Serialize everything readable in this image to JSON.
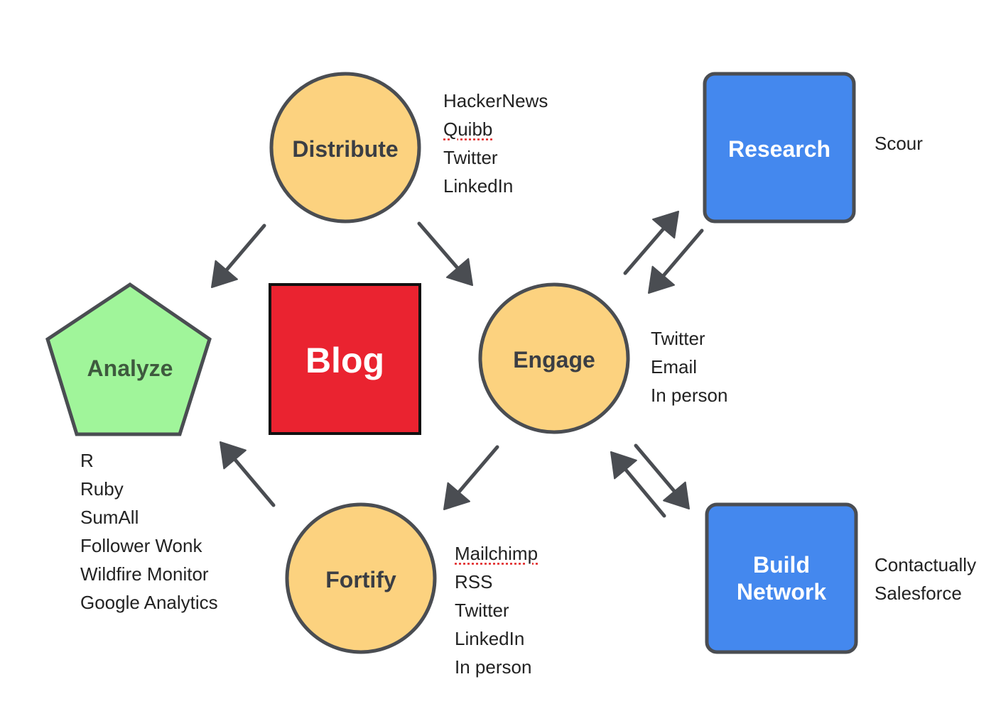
{
  "colors": {
    "circle": "#fcd27f",
    "box_blue": "#4488ee",
    "blog": "#ea2330",
    "pentagon": "#a0f59a",
    "stroke": "#4a4d52"
  },
  "nodes": {
    "distribute": {
      "label": "Distribute",
      "tools": [
        "HackerNews",
        "Quibb",
        "Twitter",
        "LinkedIn"
      ]
    },
    "research": {
      "label": "Research",
      "tools": [
        "Scour"
      ]
    },
    "analyze": {
      "label": "Analyze",
      "tools": [
        "R",
        "Ruby",
        "SumAll",
        "Follower Wonk",
        "Wildfire Monitor",
        "Google Analytics"
      ]
    },
    "blog": {
      "label": "Blog"
    },
    "engage": {
      "label": "Engage",
      "tools": [
        "Twitter",
        "Email",
        "In person"
      ]
    },
    "fortify": {
      "label": "Fortify",
      "tools": [
        "Mailchimp",
        "RSS",
        "Twitter",
        "LinkedIn",
        "In person"
      ]
    },
    "build_network": {
      "label_line1": "Build",
      "label_line2": "Network",
      "tools": [
        "Contactually",
        "Salesforce"
      ]
    }
  },
  "edges": [
    {
      "from": "distribute",
      "to": "analyze"
    },
    {
      "from": "distribute",
      "to": "engage"
    },
    {
      "from": "engage",
      "to": "research"
    },
    {
      "from": "research",
      "to": "engage"
    },
    {
      "from": "engage",
      "to": "fortify"
    },
    {
      "from": "fortify",
      "to": "analyze"
    },
    {
      "from": "build_network",
      "to": "engage"
    },
    {
      "from": "engage",
      "to": "build_network"
    }
  ]
}
